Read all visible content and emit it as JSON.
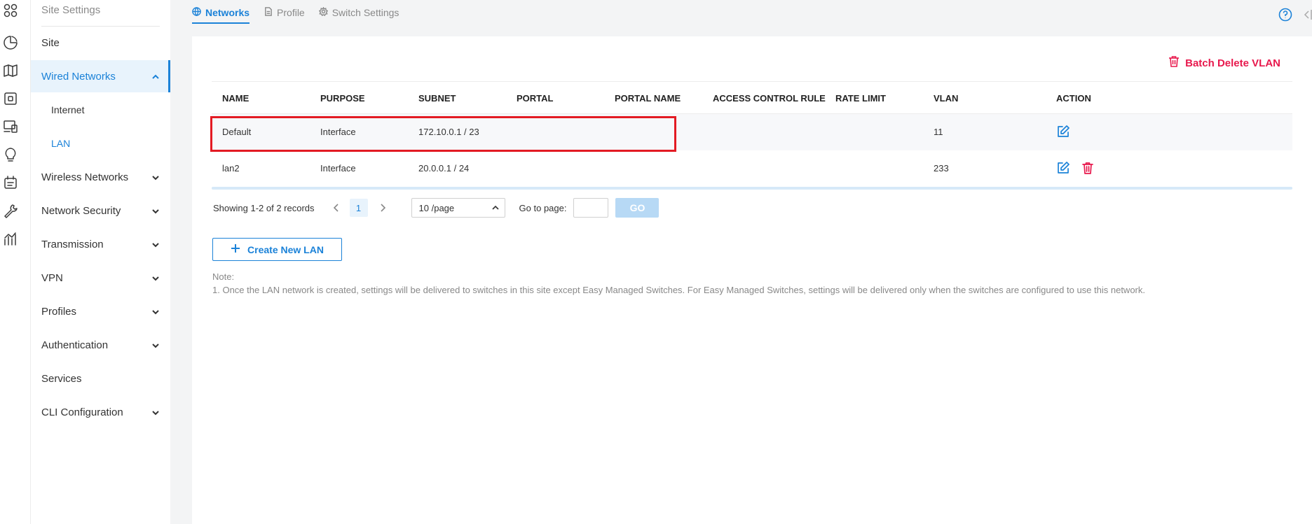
{
  "rail": {
    "icons": [
      "dashboard-icon",
      "statistics-icon",
      "map-icon",
      "devices-icon",
      "clients-icon",
      "insights-icon",
      "logs-icon",
      "tools-icon",
      "reports-icon"
    ]
  },
  "sidebar": {
    "title": "Site Settings",
    "items": [
      {
        "label": "Site"
      },
      {
        "label": "Wired Networks",
        "expanded": true
      },
      {
        "label": "Internet",
        "sub": true
      },
      {
        "label": "LAN",
        "sub": true,
        "selected": true
      },
      {
        "label": "Wireless Networks"
      },
      {
        "label": "Network Security"
      },
      {
        "label": "Transmission"
      },
      {
        "label": "VPN"
      },
      {
        "label": "Profiles"
      },
      {
        "label": "Authentication"
      },
      {
        "label": "Services"
      },
      {
        "label": "CLI Configuration"
      }
    ]
  },
  "tabs": [
    {
      "label": "Networks",
      "icon": "globe-icon",
      "active": true
    },
    {
      "label": "Profile",
      "icon": "document-icon"
    },
    {
      "label": "Switch Settings",
      "icon": "gear-icon"
    }
  ],
  "toolbar": {
    "batch_delete_label": "Batch Delete VLAN"
  },
  "table": {
    "columns": [
      "NAME",
      "PURPOSE",
      "SUBNET",
      "PORTAL",
      "PORTAL NAME",
      "ACCESS CONTROL RULE",
      "RATE LIMIT",
      "VLAN",
      "ACTION"
    ],
    "rows": [
      {
        "name": "Default",
        "purpose": "Interface",
        "subnet": "172.10.0.1 / 23",
        "portal": "",
        "portal_name": "",
        "acl": "",
        "rate_limit": "",
        "vlan": "11",
        "actions": [
          "edit"
        ]
      },
      {
        "name": "lan2",
        "purpose": "Interface",
        "subnet": "20.0.0.1 / 24",
        "portal": "",
        "portal_name": "",
        "acl": "",
        "rate_limit": "",
        "vlan": "233",
        "actions": [
          "edit",
          "delete"
        ]
      }
    ]
  },
  "pagination": {
    "summary": "Showing 1-2 of 2 records",
    "current_page": "1",
    "page_size": "10 /page",
    "goto_label": "Go to page:",
    "go_label": "GO"
  },
  "create_button_label": "Create New LAN",
  "note": {
    "title": "Note:",
    "line1": "1. Once the LAN network is created, settings will be delivered to switches in this site except Easy Managed Switches. For Easy Managed Switches, settings will be delivered only when the switches are configured to use this network."
  },
  "colors": {
    "accent": "#1b82d8",
    "danger": "#e8194d",
    "highlight": "#e31b23"
  }
}
